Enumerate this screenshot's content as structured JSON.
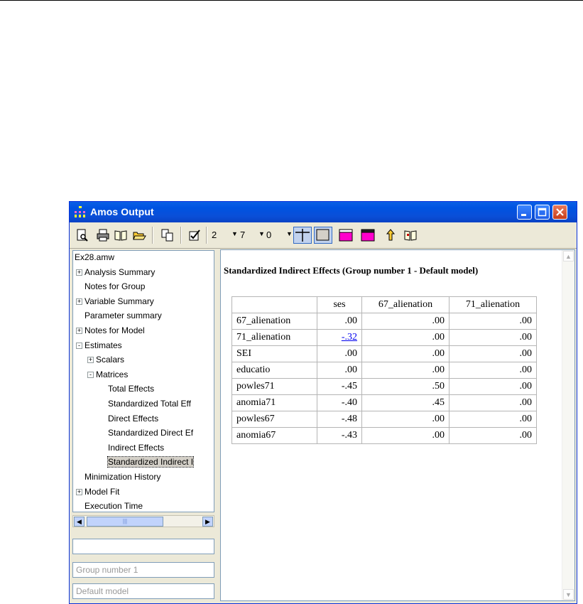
{
  "window": {
    "title": "Amos Output",
    "colors": {
      "titlebar": "#0053e1",
      "close": "#c63d1a",
      "pink": "#ff00cc"
    }
  },
  "toolbar": {
    "icons": [
      "print-preview-icon",
      "print-icon",
      "book-icon",
      "open-folder-icon",
      "copy-icon",
      "checkbox-icon",
      "grid-lines-icon",
      "cell-border-icon",
      "table-format-icon",
      "color-icon",
      "up-arrow-icon",
      "help-book-icon"
    ],
    "decimals": "2",
    "width": "7",
    "digits": "0"
  },
  "tree": {
    "items": [
      {
        "label": "Ex28.amw",
        "level": 0,
        "toggle": ""
      },
      {
        "label": "Analysis Summary",
        "level": 0,
        "toggle": "+"
      },
      {
        "label": "Notes for Group",
        "level": 0,
        "toggle": ""
      },
      {
        "label": "Variable Summary",
        "level": 0,
        "toggle": "+"
      },
      {
        "label": "Parameter summary",
        "level": 0,
        "toggle": ""
      },
      {
        "label": "Notes for Model",
        "level": 0,
        "toggle": "+"
      },
      {
        "label": "Estimates",
        "level": 0,
        "toggle": "-"
      },
      {
        "label": "Scalars",
        "level": 1,
        "toggle": "+"
      },
      {
        "label": "Matrices",
        "level": 1,
        "toggle": "-"
      },
      {
        "label": "Total Effects",
        "level": 2,
        "toggle": ""
      },
      {
        "label": "Standardized Total Eff",
        "level": 2,
        "toggle": ""
      },
      {
        "label": "Direct Effects",
        "level": 2,
        "toggle": ""
      },
      {
        "label": "Standardized Direct Ef",
        "level": 2,
        "toggle": ""
      },
      {
        "label": "Indirect Effects",
        "level": 2,
        "toggle": ""
      },
      {
        "label": "Standardized Indirect I",
        "level": 2,
        "toggle": "",
        "selected": true
      },
      {
        "label": "Minimization History",
        "level": 0,
        "toggle": ""
      },
      {
        "label": "Model Fit",
        "level": 0,
        "toggle": "+"
      },
      {
        "label": "Execution Time",
        "level": 0,
        "toggle": ""
      }
    ],
    "group_field": "",
    "group_name": "Group number 1",
    "model_name": "Default model"
  },
  "output": {
    "heading": "Standardized Indirect Effects (Group number 1 - Default model)",
    "columns": [
      "ses",
      "67_alienation",
      "71_alienation"
    ],
    "rows": [
      {
        "label": "67_alienation",
        "values": [
          ".00",
          ".00",
          ".00"
        ]
      },
      {
        "label": "71_alienation",
        "values": [
          "-.32",
          ".00",
          ".00"
        ],
        "link": 0
      },
      {
        "label": "SEI",
        "values": [
          ".00",
          ".00",
          ".00"
        ]
      },
      {
        "label": "educatio",
        "values": [
          ".00",
          ".00",
          ".00"
        ]
      },
      {
        "label": "powles71",
        "values": [
          "-.45",
          ".50",
          ".00"
        ]
      },
      {
        "label": "anomia71",
        "values": [
          "-.40",
          ".45",
          ".00"
        ]
      },
      {
        "label": "powles67",
        "values": [
          "-.48",
          ".00",
          ".00"
        ]
      },
      {
        "label": "anomia67",
        "values": [
          "-.43",
          ".00",
          ".00"
        ]
      }
    ]
  }
}
